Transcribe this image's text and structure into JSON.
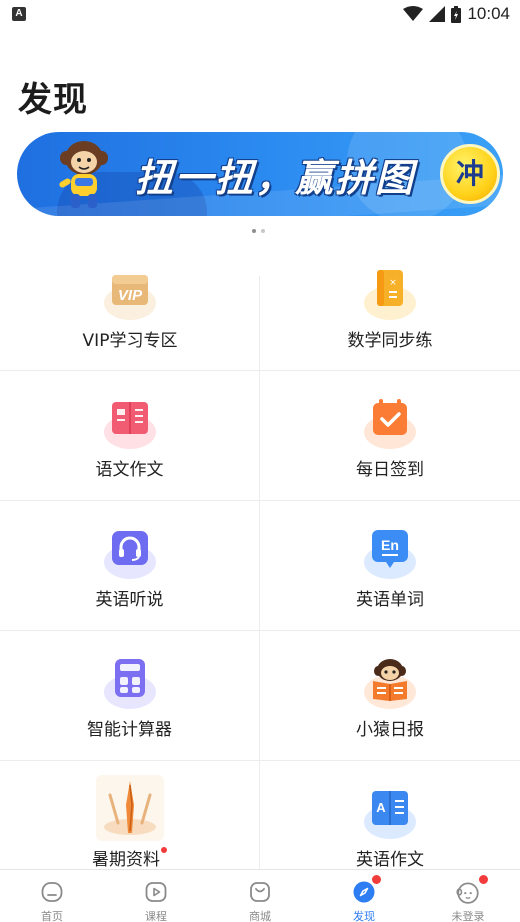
{
  "status_bar": {
    "app_indicator": "A",
    "time": "10:04"
  },
  "page_title": "发现",
  "banner": {
    "slogan": "扭一扭，赢拼图",
    "go_button": "冲",
    "page_count": 2,
    "active_page": 1
  },
  "features": [
    {
      "label": "VIP学习专区",
      "icon": "vip-icon",
      "color": "#e6b574",
      "halo": "#fbf0df"
    },
    {
      "label": "数学同步练",
      "icon": "math-book-icon",
      "color": "#f7b128",
      "halo": "#fff1cf"
    },
    {
      "label": "语文作文",
      "icon": "chinese-book-icon",
      "color": "#f25c72",
      "halo": "#ffe0e5"
    },
    {
      "label": "每日签到",
      "icon": "calendar-check-icon",
      "color": "#fb7d35",
      "halo": "#ffe6d6"
    },
    {
      "label": "英语听说",
      "icon": "headset-icon",
      "color": "#6e6cf0",
      "halo": "#e6e6ff"
    },
    {
      "label": "英语单词",
      "icon": "en-word-icon",
      "color": "#3b8df5",
      "halo": "#dceaff"
    },
    {
      "label": "智能计算器",
      "icon": "calculator-icon",
      "color": "#7c6ff2",
      "halo": "#e8e6ff"
    },
    {
      "label": "小猿日报",
      "icon": "monkey-news-icon",
      "color": "#f47a2c",
      "halo": "#ffe8d8"
    },
    {
      "label": "暑期资料",
      "icon": "summer-material-icon",
      "color": "#f08a3a",
      "halo": "#fdf1e2",
      "badge": true
    },
    {
      "label": "英语作文",
      "icon": "english-essay-icon",
      "color": "#3a88f0",
      "halo": "#dceaff"
    }
  ],
  "tabbar": {
    "tabs": [
      {
        "label": "首页",
        "icon": "home-icon",
        "active": false
      },
      {
        "label": "课程",
        "icon": "play-icon",
        "active": false
      },
      {
        "label": "商城",
        "icon": "shop-bag-icon",
        "active": false
      },
      {
        "label": "发现",
        "icon": "compass-icon",
        "active": true,
        "badge": true
      },
      {
        "label": "未登录",
        "icon": "avatar-icon",
        "active": false,
        "badge": true
      }
    ]
  },
  "colors": {
    "accent": "#2f7df2",
    "badge": "#f23b3b",
    "banner": "#2b8af0"
  }
}
